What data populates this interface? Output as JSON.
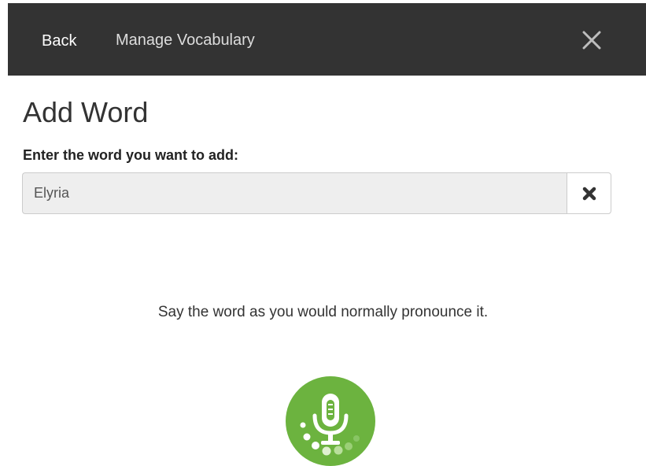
{
  "topbar": {
    "back_label": "Back",
    "title": "Manage Vocabulary"
  },
  "main": {
    "heading": "Add Word",
    "field_label": "Enter the word you want to add:",
    "word_value": "Elyria",
    "instruction": "Say the word as you would normally pronounce it."
  },
  "icons": {
    "close": "close-icon",
    "clear": "clear-icon",
    "microphone": "microphone-icon"
  },
  "colors": {
    "topbar_bg": "#333333",
    "mic_green": "#6cb33f",
    "input_bg": "#eeeeee"
  }
}
